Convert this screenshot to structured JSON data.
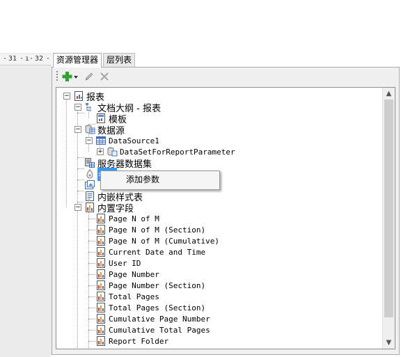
{
  "ruler": {
    "marks": [
      "31",
      "32"
    ]
  },
  "tabs": [
    {
      "label": "资源管理器",
      "active": true
    },
    {
      "label": "层列表",
      "active": false
    }
  ],
  "toolbar": {
    "add_icon": "green-plus-icon",
    "edit_icon": "pencil-icon",
    "delete_icon": "x-delete-icon"
  },
  "tree": {
    "root": {
      "label": "报表",
      "icon": "report-icon"
    },
    "doc_outline": {
      "label": "文档大纲 - 报表",
      "icon": "outline-icon"
    },
    "template": {
      "label": "模板",
      "icon": "template-icon"
    },
    "datasource_folder": {
      "label": "数据源",
      "icon": "database-icon"
    },
    "datasource1": {
      "label": "DataSource1",
      "icon": "datasource-icon"
    },
    "dataset": {
      "label": "DataSetForReportParameter",
      "icon": "dataset-icon"
    },
    "server_datasets": {
      "label": "服务器数据集",
      "icon": "server-dataset-icon"
    },
    "parameters": {
      "label": "参数",
      "icon": "parameter-icon"
    },
    "hidden_item": {
      "label": "",
      "icon": "image-icon"
    },
    "embedded_styles": {
      "label": "内嵌样式表",
      "icon": "stylesheet-icon"
    },
    "builtin_fields": {
      "label": "内置字段",
      "icon": "fields-icon"
    },
    "fields": [
      "Page N of M",
      "Page N of M (Section)",
      "Page N of M (Cumulative)",
      "Current Date and Time",
      "User ID",
      "Page Number",
      "Page Number (Section)",
      "Total Pages",
      "Total Pages (Section)",
      "Cumulative Page Number",
      "Cumulative Total Pages",
      "Report Folder"
    ]
  },
  "context_menu": {
    "items": [
      {
        "label": "添加参数"
      }
    ]
  },
  "scrollbar": {
    "up": "▲",
    "down": "▼"
  }
}
